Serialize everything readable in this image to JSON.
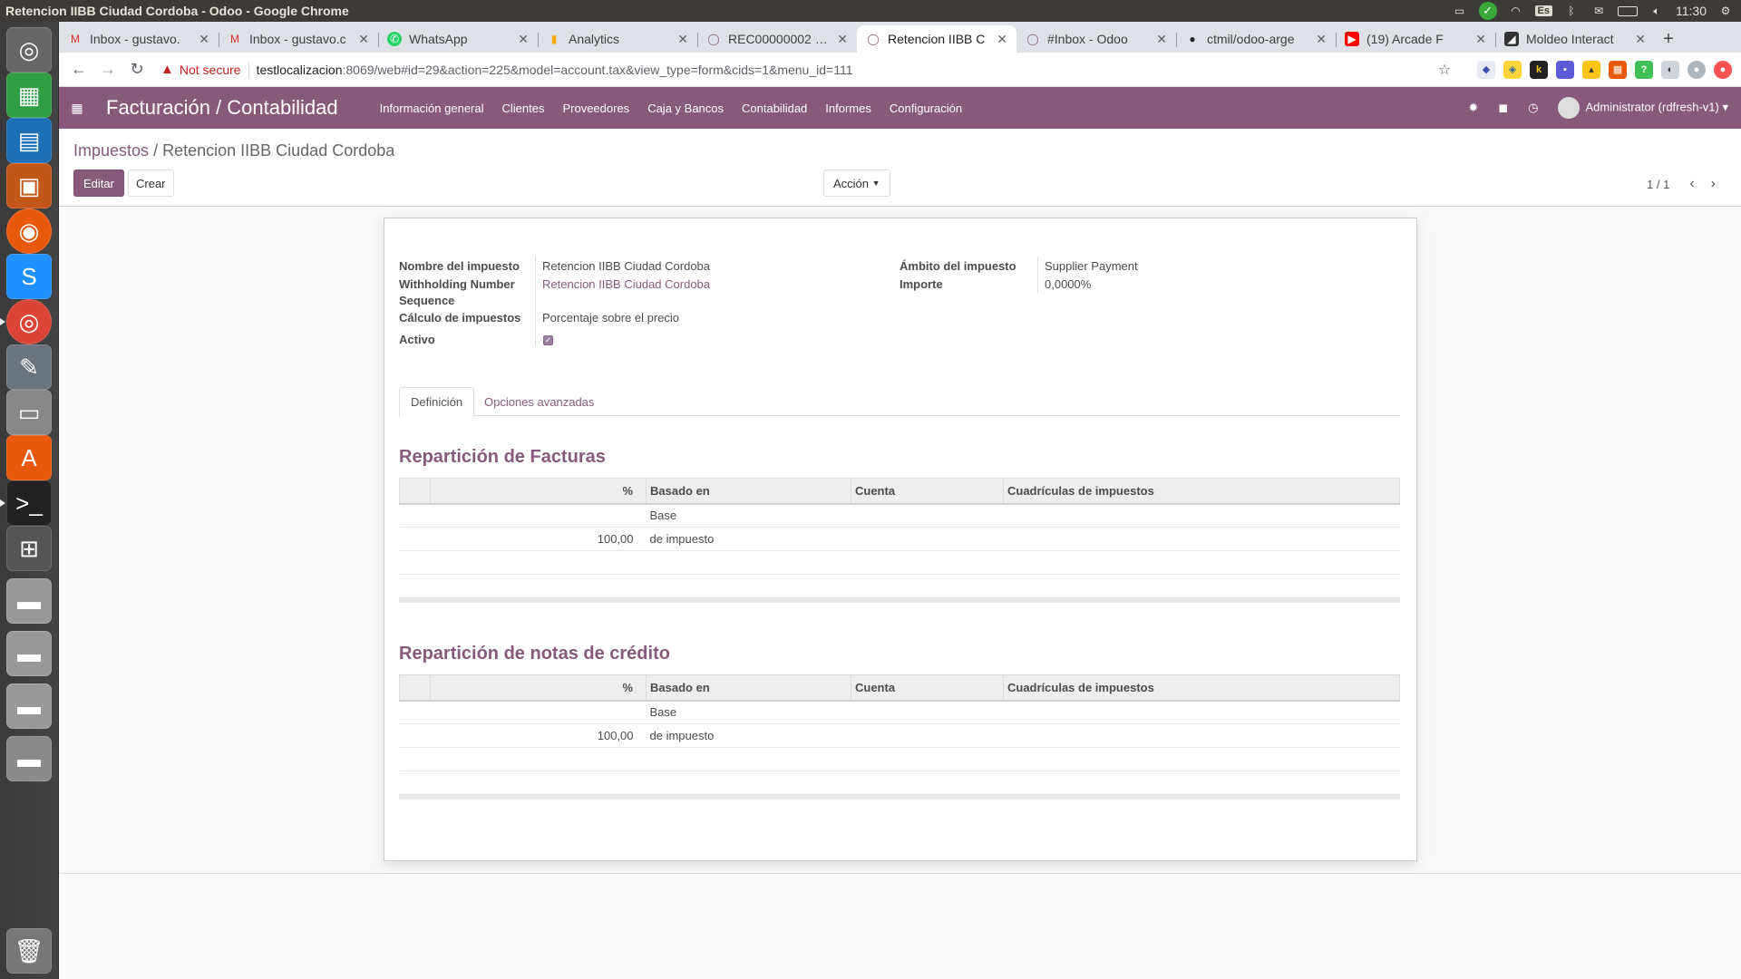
{
  "os": {
    "window_title": "Retencion IIBB Ciudad Cordoba - Odoo - Google Chrome",
    "clock": "11:30",
    "keyboard": "Es"
  },
  "browser": {
    "tabs": [
      {
        "label": "Inbox - gustavo.",
        "icon": "gmail-icon",
        "color": "#d93025"
      },
      {
        "label": "Inbox - gustavo.c",
        "icon": "gmail-icon",
        "color": "#d93025"
      },
      {
        "label": "WhatsApp",
        "icon": "whatsapp-icon",
        "color": "#25d366"
      },
      {
        "label": "Analytics",
        "icon": "analytics-icon",
        "color": "#f9ab00"
      },
      {
        "label": "REC00000002 - O",
        "icon": "odoo-icon",
        "color": "#875a7b"
      },
      {
        "label": "Retencion IIBB C",
        "icon": "odoo-icon",
        "color": "#875a7b"
      },
      {
        "label": "#Inbox - Odoo",
        "icon": "odoo-icon",
        "color": "#875a7b"
      },
      {
        "label": "ctmil/odoo-arge",
        "icon": "github-icon",
        "color": "#24292e"
      },
      {
        "label": "(19) Arcade F",
        "icon": "youtube-icon",
        "color": "#ff0000"
      },
      {
        "label": "Moldeo Interact",
        "icon": "site-icon",
        "color": "#333333"
      }
    ],
    "active_tab": 5,
    "not_secure": "Not secure",
    "url_host": "testlocalizacion",
    "url_path": ":8069/web#id=29&action=225&model=account.tax&view_type=form&cids=1&menu_id=111"
  },
  "odoo": {
    "app_title": "Facturación / Contabilidad",
    "menu": [
      "Información general",
      "Clientes",
      "Proveedores",
      "Caja y Bancos",
      "Contabilidad",
      "Informes",
      "Configuración"
    ],
    "user": "Administrator (rdfresh-v1)",
    "accent": "#875a7b"
  },
  "control": {
    "breadcrumb_parent": "Impuestos",
    "breadcrumb_sep": "/",
    "breadcrumb_current": "Retencion IIBB Ciudad Cordoba",
    "edit_label": "Editar",
    "create_label": "Crear",
    "action_label": "Acción",
    "pager": "1 / 1"
  },
  "form": {
    "labels": {
      "name": "Nombre del impuesto",
      "withholding_1": "Withholding Number",
      "withholding_2": "Sequence",
      "computation": "Cálculo de impuestos",
      "active": "Activo",
      "scope": "Ámbito del impuesto",
      "amount": "Importe"
    },
    "values": {
      "name": "Retencion IIBB Ciudad Cordoba",
      "withholding": "Retencion IIBB Ciudad Cordoba",
      "computation": "Porcentaje sobre el precio",
      "active": true,
      "scope": "Supplier Payment",
      "amount": "0,0000%"
    },
    "tabs": [
      "Definición",
      "Opciones avanzadas"
    ],
    "invoice_section": "Repartición de Facturas",
    "credit_section": "Repartición de notas de crédito",
    "columns": [
      "%",
      "Basado en",
      "Cuenta",
      "Cuadrículas de impuestos"
    ],
    "rows": [
      {
        "percent": "",
        "based_on": "Base",
        "account": "",
        "grids": ""
      },
      {
        "percent": "100,00",
        "based_on": "de impuesto",
        "account": "",
        "grids": ""
      }
    ]
  }
}
